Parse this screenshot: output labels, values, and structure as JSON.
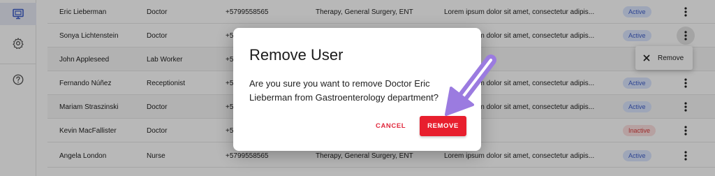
{
  "sidebar": {
    "items": [
      {
        "icon": "monitor-icon",
        "active": true
      },
      {
        "icon": "gear-icon",
        "active": false
      },
      {
        "icon": "help-icon",
        "active": false
      }
    ]
  },
  "table": {
    "rows": [
      {
        "name": "Eric Lieberman",
        "role": "Doctor",
        "phone": "+5799558565",
        "specialty": "Therapy, General Surgery, ENT",
        "note": "Lorem ipsum dolor sit amet, consectetur adipis...",
        "status": "Active"
      },
      {
        "name": "Sonya Lichtenstein",
        "role": "Doctor",
        "phone": "+5",
        "specialty": "",
        "note": "Lorem ipsum dolor sit amet, consectetur adipis...",
        "status": "Active"
      },
      {
        "name": "John Appleseed",
        "role": "Lab Worker",
        "phone": "+5",
        "specialty": "",
        "note": "",
        "status": ""
      },
      {
        "name": "Fernando Núñez",
        "role": "Receptionist",
        "phone": "+5",
        "specialty": "",
        "note": "Lorem ipsum dolor sit amet, consectetur adipis...",
        "status": "Active"
      },
      {
        "name": "Mariam Straszinski",
        "role": "Doctor",
        "phone": "+5",
        "specialty": "",
        "note": "Lorem ipsum dolor sit amet, consectetur adipis...",
        "status": "Active"
      },
      {
        "name": "Kevin MacFallister",
        "role": "Doctor",
        "phone": "+5",
        "specialty": "",
        "note": "",
        "status": "Inactive"
      },
      {
        "name": "Angela London",
        "role": "Nurse",
        "phone": "+5799558565",
        "specialty": "Therapy, General Surgery, ENT",
        "note": "Lorem ipsum dolor sit amet, consectetur adipis...",
        "status": "Active"
      }
    ]
  },
  "row_menu": {
    "remove_label": "Remove"
  },
  "dialog": {
    "title": "Remove User",
    "body": "Are you sure you want to remove Doctor Eric Lieberman from Gastroenterology department?",
    "cancel_label": "CANCEL",
    "remove_label": "REMOVE"
  },
  "colors": {
    "accent": "#3d5ec9",
    "danger": "#e81f2e",
    "arrow": "#9b7be0"
  }
}
